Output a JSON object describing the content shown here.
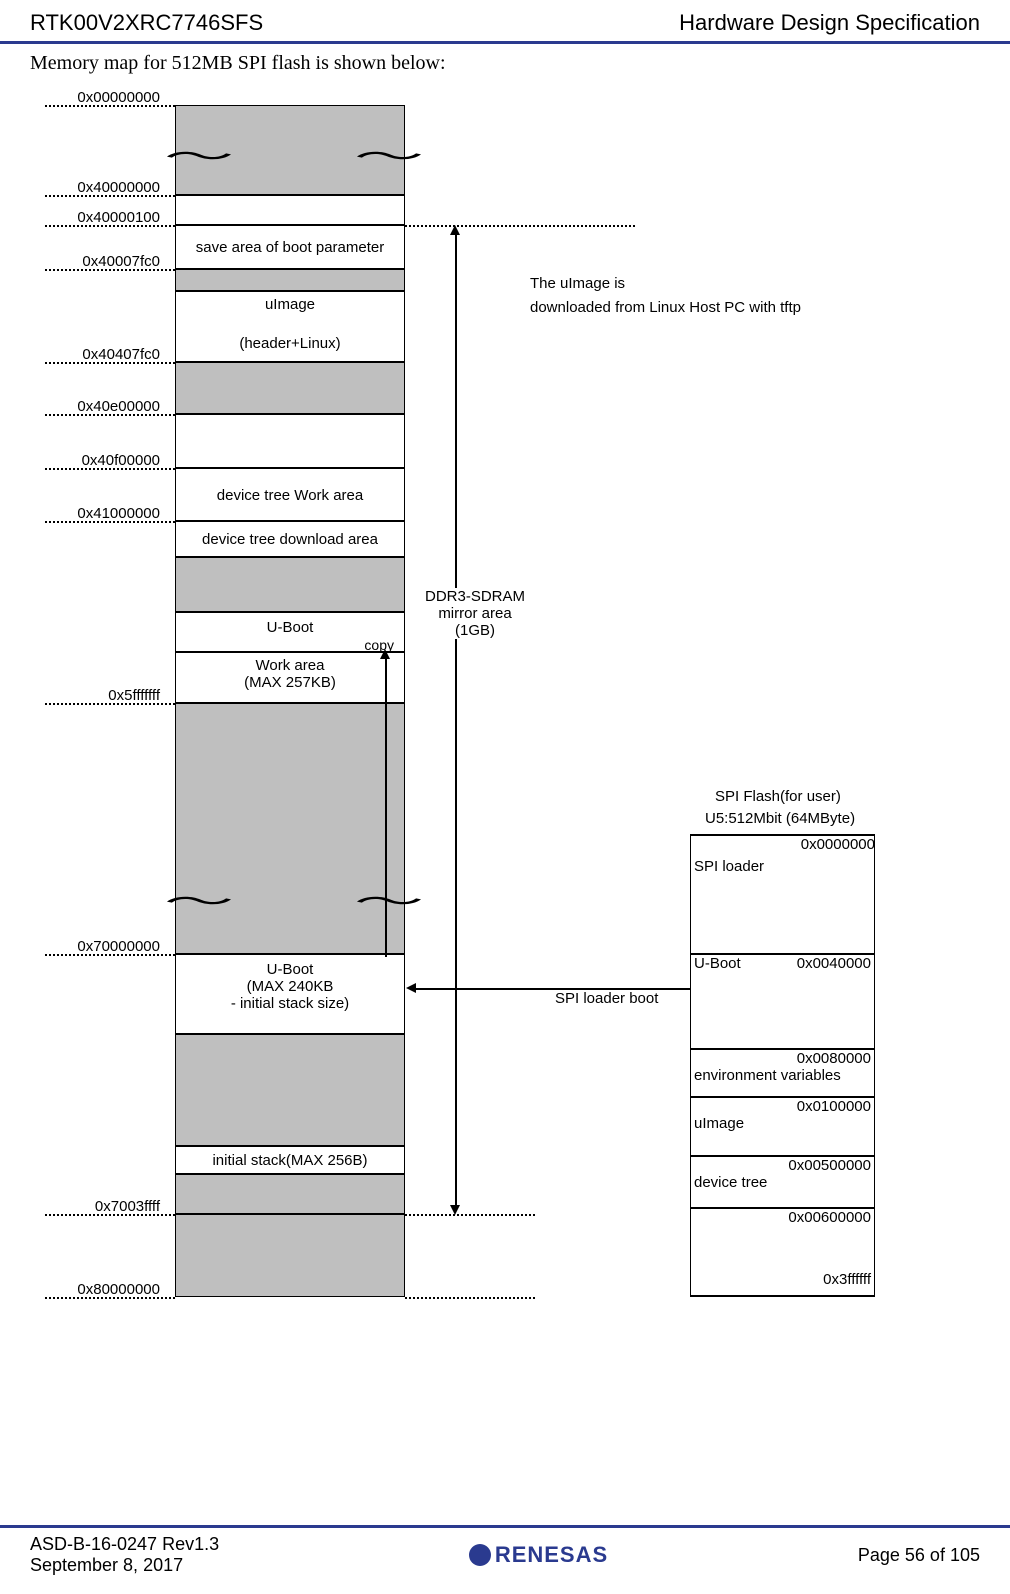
{
  "header": {
    "left": "RTK00V2XRC7746SFS",
    "right": "Hardware Design Specification"
  },
  "intro": "Memory map for 512MB SPI flash is shown below:",
  "addr": {
    "a0": "0x00000000",
    "a1": "0x40000000",
    "a2": "0x40000100",
    "a3": "0x40007fc0",
    "a4": "0x40407fc0",
    "a5": "0x40e00000",
    "a6": "0x40f00000",
    "a7": "0x41000000",
    "a8": "0x5fffffff",
    "a9": "0x70000000",
    "a10": "0x7003ffff",
    "a11": "0x80000000"
  },
  "cells": {
    "boot_param": "save area of boot parameter",
    "uimage_hdr1": "uImage",
    "uimage_hdr2": "(header+Linux)",
    "dt_work": "device tree Work area",
    "dt_dl": "device tree download area",
    "uboot_copy": "U-Boot",
    "copy_label": "copy",
    "work_area1": "Work area",
    "work_area2": "(MAX 257KB)",
    "uboot2_l1": "U-Boot",
    "uboot2_l2": "(MAX 240KB",
    "uboot2_l3": "- initial stack size)",
    "initial_stack": "initial stack(MAX 256B)"
  },
  "annotations": {
    "uimage_note1": "The uImage is",
    "uimage_note2": "downloaded from Linux Host PC with tftp",
    "mirror1": "DDR3-SDRAM",
    "mirror2": "mirror area",
    "mirror3": "(1GB)",
    "spi_loader_boot": "SPI loader boot"
  },
  "spi": {
    "title1": "SPI Flash(for user)",
    "title2": "U5:512Mbit (64MByte)",
    "r0_label": "SPI loader",
    "r0_addr": "0x0000000",
    "r1_label": "U-Boot",
    "r1_addr": "0x0040000",
    "r2_label": "environment variables",
    "r2_addr": "0x0080000",
    "r3_label": "uImage",
    "r3_addr": "0x0100000",
    "r4_label": "device tree",
    "r4_addr": "0x00500000",
    "r5_addr": "0x00600000",
    "r6_addr": "0x3ffffff"
  },
  "footer": {
    "doc": "ASD-B-16-0247   Rev1.3",
    "date": "September 8, 2017",
    "page": "Page  56  of 105",
    "logo": "RENESAS"
  }
}
